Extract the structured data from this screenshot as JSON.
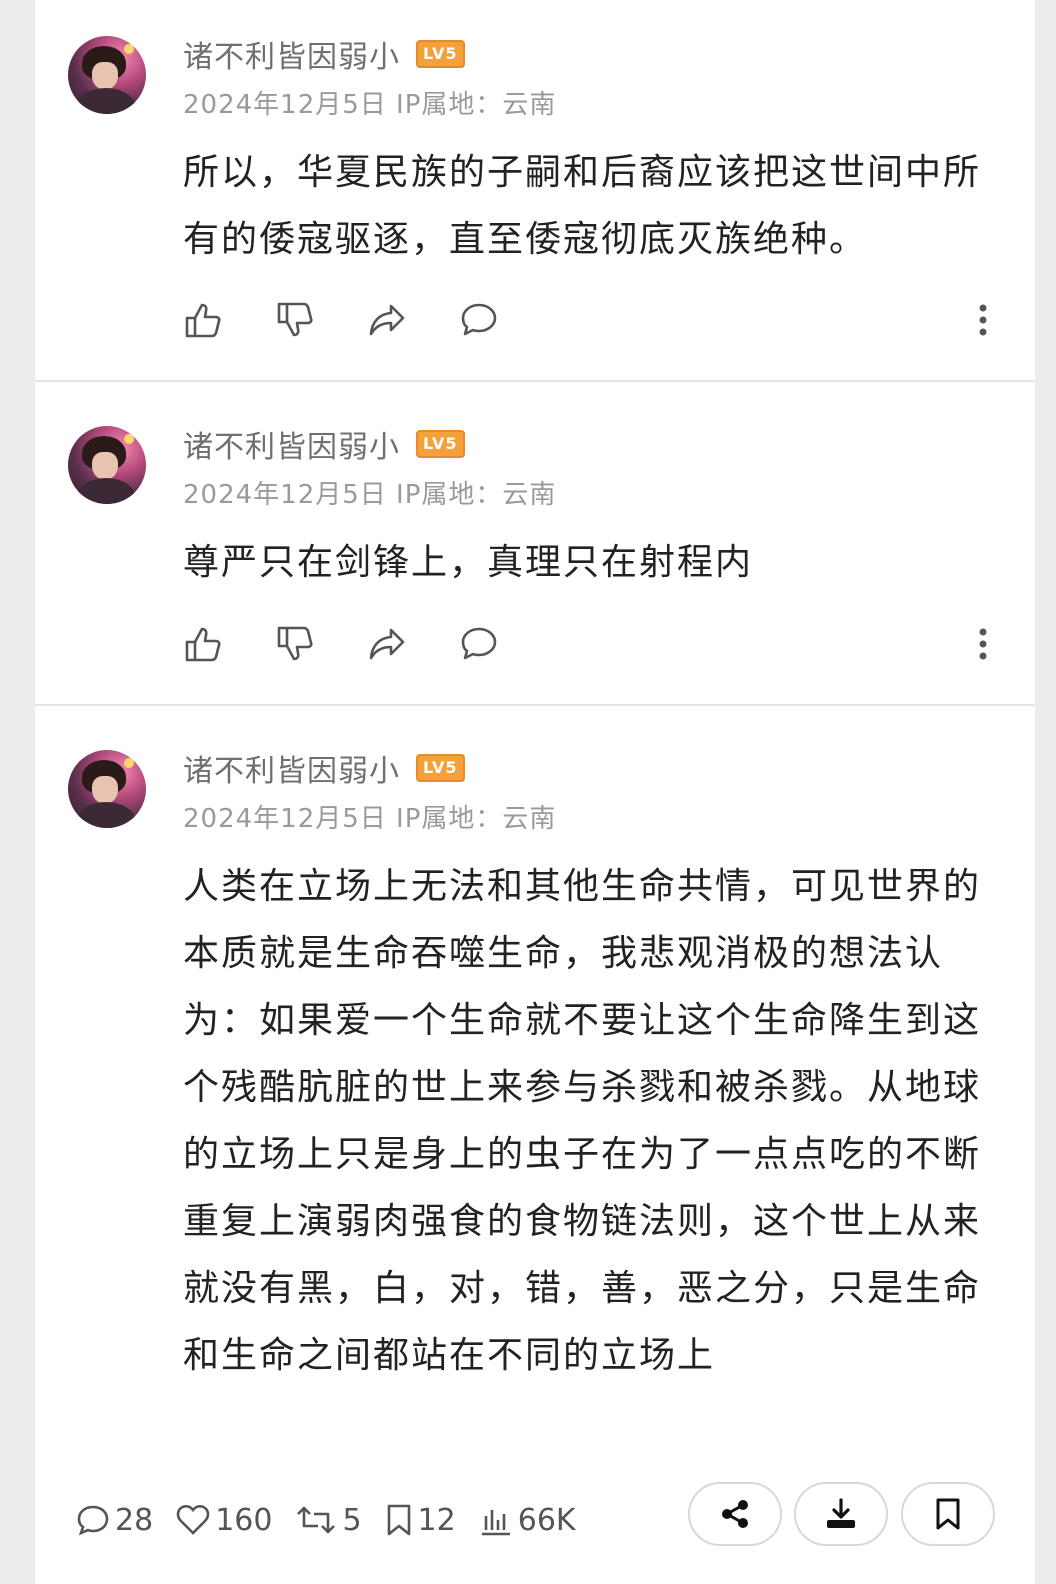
{
  "comments": [
    {
      "username": "诸不利皆因弱小",
      "level_badge": "LV5",
      "meta": "2024年12月5日  IP属地：云南",
      "text": "所以，华夏民族的子嗣和后裔应该把这世间中所有的倭寇驱逐，直至倭寇彻底灭族绝种。"
    },
    {
      "username": "诸不利皆因弱小",
      "level_badge": "LV5",
      "meta": "2024年12月5日  IP属地：云南",
      "text": "尊严只在剑锋上，真理只在射程内"
    },
    {
      "username": "诸不利皆因弱小",
      "level_badge": "LV5",
      "meta": "2024年12月5日  IP属地：云南",
      "text": "人类在立场上无法和其他生命共情，可见世界的本质就是生命吞噬生命，我悲观消极的想法认为：如果爱一个生命就不要让这个生命降生到这个残酷肮脏的世上来参与杀戮和被杀戮。从地球的立场上只是身上的虫子在为了一点点吃的不断重复上演弱肉强食的食物链法则，这个世上从来就没有黑，白，对，错，善，恶之分，只是生命和生命之间都站在不同的立场上"
    }
  ],
  "footer": {
    "replies": "28",
    "likes": "160",
    "reposts": "5",
    "bookmarks": "12",
    "views": "66K"
  },
  "icons": {
    "like": "thumbs-up-icon",
    "dislike": "thumbs-down-icon",
    "share": "share-arrow-icon",
    "reply": "comment-bubble-icon",
    "more": "more-vertical-icon"
  },
  "colors": {
    "badge": "#f5a13b",
    "meta_text": "#9a9a9a",
    "body_text": "#222222"
  }
}
